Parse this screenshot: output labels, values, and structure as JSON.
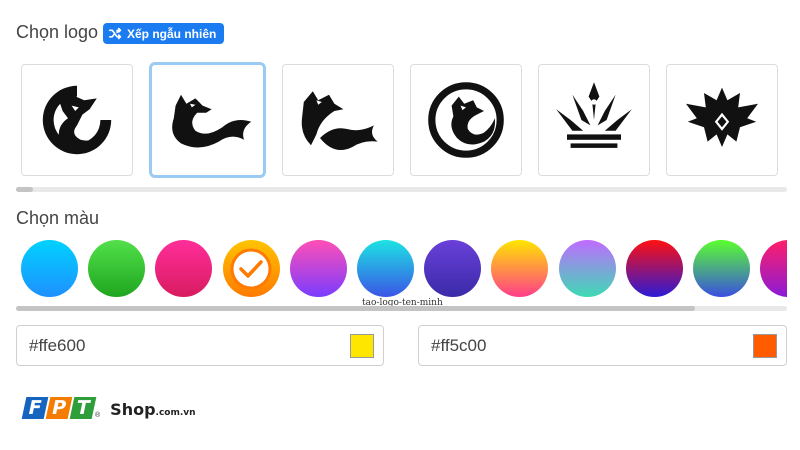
{
  "logo_section": {
    "title": "Chọn logo",
    "shuffle_label": "Xếp ngẫu nhiên",
    "logos": [
      {
        "icon": "fox-circle-logo-icon",
        "selected": false
      },
      {
        "icon": "fox-wave-logo-icon",
        "selected": true
      },
      {
        "icon": "fox-tail-logo-icon",
        "selected": false
      },
      {
        "icon": "fox-ring-logo-icon",
        "selected": false
      },
      {
        "icon": "crown-spikes-logo-icon",
        "selected": false
      },
      {
        "icon": "crown-jewel-logo-icon",
        "selected": false
      }
    ]
  },
  "color_section": {
    "title": "Chọn màu",
    "swatches": [
      {
        "from": "#00d2ff",
        "to": "#1e90ff",
        "selected": false
      },
      {
        "from": "#52e04a",
        "to": "#1fa51f",
        "selected": false
      },
      {
        "from": "#ff2e9a",
        "to": "#d81b60",
        "selected": false
      },
      {
        "from": "#ffc400",
        "to": "#ff7a00",
        "selected": true
      },
      {
        "from": "#ff4fb6",
        "to": "#7a3cff",
        "selected": false
      },
      {
        "from": "#1de3e3",
        "to": "#3a55e6",
        "selected": false
      },
      {
        "from": "#6a3fd9",
        "to": "#3a2ba8",
        "selected": false
      },
      {
        "from": "#ffe600",
        "to": "#ff3d8b",
        "selected": false
      },
      {
        "from": "#c06bff",
        "to": "#3ddbb3",
        "selected": false
      },
      {
        "from": "#ff1010",
        "to": "#2b1bd6",
        "selected": false
      },
      {
        "from": "#5bff2e",
        "to": "#3a4fe0",
        "selected": false
      },
      {
        "from": "#ff1f6a",
        "to": "#8a1bd6",
        "selected": false
      }
    ],
    "watermark": "tao-logo-ten-minh"
  },
  "fields": {
    "color1": {
      "value": "#ffe600",
      "chip": "#ffe600"
    },
    "color2": {
      "value": "#ff5c00",
      "chip": "#ff5c00"
    }
  },
  "brand": {
    "letters": [
      "F",
      "P",
      "T"
    ],
    "tile_colors": [
      "#1565c0",
      "#f57c00",
      "#2e9e3a"
    ],
    "reg": "®",
    "shop": "Shop",
    "domain": ".com.vn"
  },
  "colors": {
    "accent": "#1a7cf0",
    "selected_border": "#9bcbf3"
  }
}
